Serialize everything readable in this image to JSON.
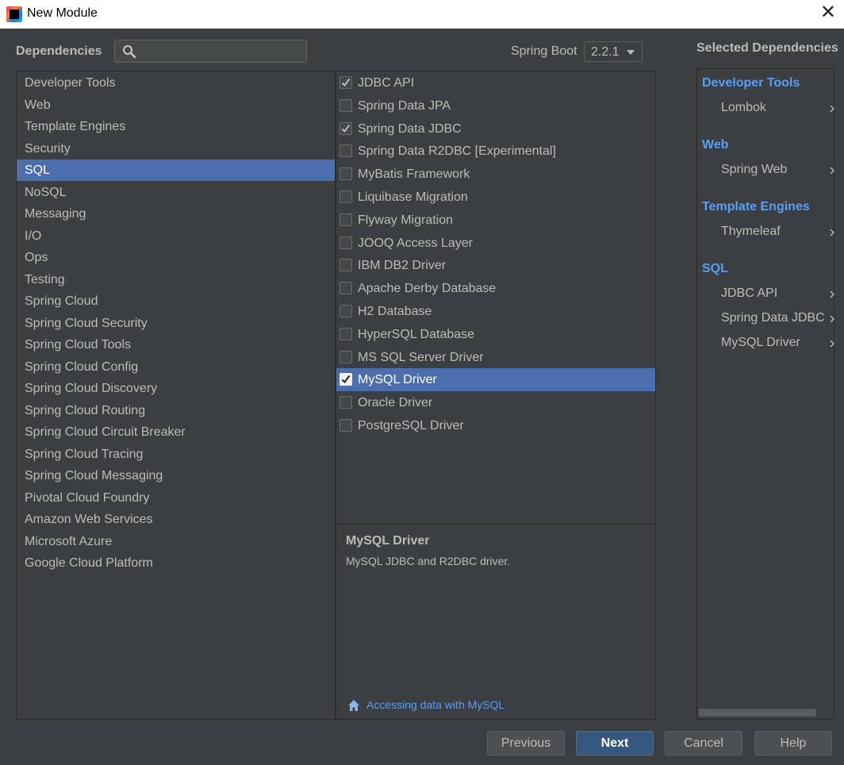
{
  "window": {
    "title": "New Module"
  },
  "header": {
    "dependencies_label": "Dependencies",
    "search_placeholder": "",
    "spring_boot_label": "Spring Boot",
    "spring_boot_version": "2.2.1",
    "selected_label": "Selected Dependencies"
  },
  "categories": [
    "Developer Tools",
    "Web",
    "Template Engines",
    "Security",
    "SQL",
    "NoSQL",
    "Messaging",
    "I/O",
    "Ops",
    "Testing",
    "Spring Cloud",
    "Spring Cloud Security",
    "Spring Cloud Tools",
    "Spring Cloud Config",
    "Spring Cloud Discovery",
    "Spring Cloud Routing",
    "Spring Cloud Circuit Breaker",
    "Spring Cloud Tracing",
    "Spring Cloud Messaging",
    "Pivotal Cloud Foundry",
    "Amazon Web Services",
    "Microsoft Azure",
    "Google Cloud Platform"
  ],
  "selected_category_index": 4,
  "dependencies": [
    {
      "name": "JDBC API",
      "checked": true
    },
    {
      "name": "Spring Data JPA",
      "checked": false
    },
    {
      "name": "Spring Data JDBC",
      "checked": true
    },
    {
      "name": "Spring Data R2DBC [Experimental]",
      "checked": false
    },
    {
      "name": "MyBatis Framework",
      "checked": false
    },
    {
      "name": "Liquibase Migration",
      "checked": false
    },
    {
      "name": "Flyway Migration",
      "checked": false
    },
    {
      "name": "JOOQ Access Layer",
      "checked": false
    },
    {
      "name": "IBM DB2 Driver",
      "checked": false
    },
    {
      "name": "Apache Derby Database",
      "checked": false
    },
    {
      "name": "H2 Database",
      "checked": false
    },
    {
      "name": "HyperSQL Database",
      "checked": false
    },
    {
      "name": "MS SQL Server Driver",
      "checked": false
    },
    {
      "name": "MySQL Driver",
      "checked": true
    },
    {
      "name": "Oracle Driver",
      "checked": false
    },
    {
      "name": "PostgreSQL Driver",
      "checked": false
    }
  ],
  "selected_dependency_index": 13,
  "description": {
    "title": "MySQL Driver",
    "text": "MySQL JDBC and R2DBC driver.",
    "link": "Accessing data with MySQL"
  },
  "selected_groups": [
    {
      "group": "Developer Tools",
      "items": [
        "Lombok"
      ]
    },
    {
      "group": "Web",
      "items": [
        "Spring Web"
      ]
    },
    {
      "group": "Template Engines",
      "items": [
        "Thymeleaf"
      ]
    },
    {
      "group": "SQL",
      "items": [
        "JDBC API",
        "Spring Data JDBC",
        "MySQL Driver"
      ]
    }
  ],
  "buttons": {
    "previous": "Previous",
    "next": "Next",
    "cancel": "Cancel",
    "help": "Help"
  },
  "colors": {
    "background": "#3c3f41",
    "selection": "#4b6eaf",
    "link": "#589df6",
    "default_button": "#365880"
  }
}
